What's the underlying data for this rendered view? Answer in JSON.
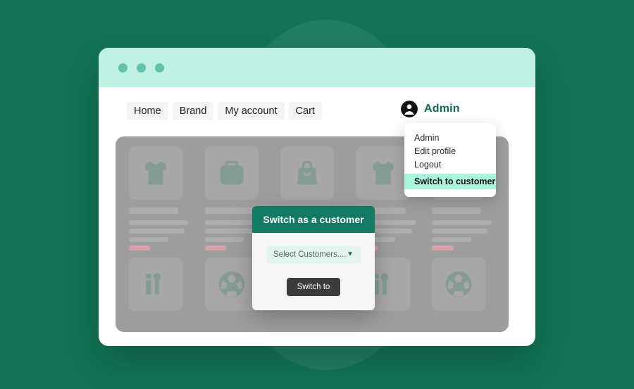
{
  "colors": {
    "page_background": "#127455",
    "deco_circle": "#2d8469",
    "titlebar": "#bff0e2",
    "titlebar_dot": "#61c3ad",
    "accent_teal": "#0f6b57",
    "modal_header": "#137a63",
    "menu_highlight": "#a9f5dd",
    "grid_overlay": "#9e9e9e",
    "button_dark": "#3b3b3b",
    "price_skeleton": "#d9a0ab"
  },
  "window": {
    "titlebar": {
      "dots": [
        "dot-one",
        "dot-two",
        "dot-three"
      ]
    }
  },
  "nav": {
    "links": [
      {
        "label": "Home"
      },
      {
        "label": "Brand"
      },
      {
        "label": "My account"
      },
      {
        "label": "Cart"
      }
    ],
    "account": {
      "icon": "user-avatar-icon",
      "name": "Admin"
    }
  },
  "user_dropdown": {
    "items": [
      {
        "label": "Admin",
        "highlighted": false
      },
      {
        "label": "Edit profile",
        "highlighted": false
      },
      {
        "label": "Logout",
        "highlighted": false
      },
      {
        "label": "Switch to customer",
        "highlighted": true
      }
    ]
  },
  "products": [
    {
      "icon": "tshirt-icon"
    },
    {
      "icon": "backpack-icon"
    },
    {
      "icon": "handbag-icon"
    },
    {
      "icon": "tshirt-icon"
    },
    {
      "icon": "handbag-icon"
    },
    {
      "icon": "cosmetics-icon"
    },
    {
      "icon": "soccer-ball-icon"
    },
    {
      "icon": "watch-icon"
    },
    {
      "icon": "cosmetics-icon"
    },
    {
      "icon": "soccer-ball-icon"
    }
  ],
  "modal": {
    "title": "Switch as a customer",
    "select": {
      "value": "Select Customers....",
      "chevron": "chevron-down-icon"
    },
    "submit_label": "Switch to"
  }
}
